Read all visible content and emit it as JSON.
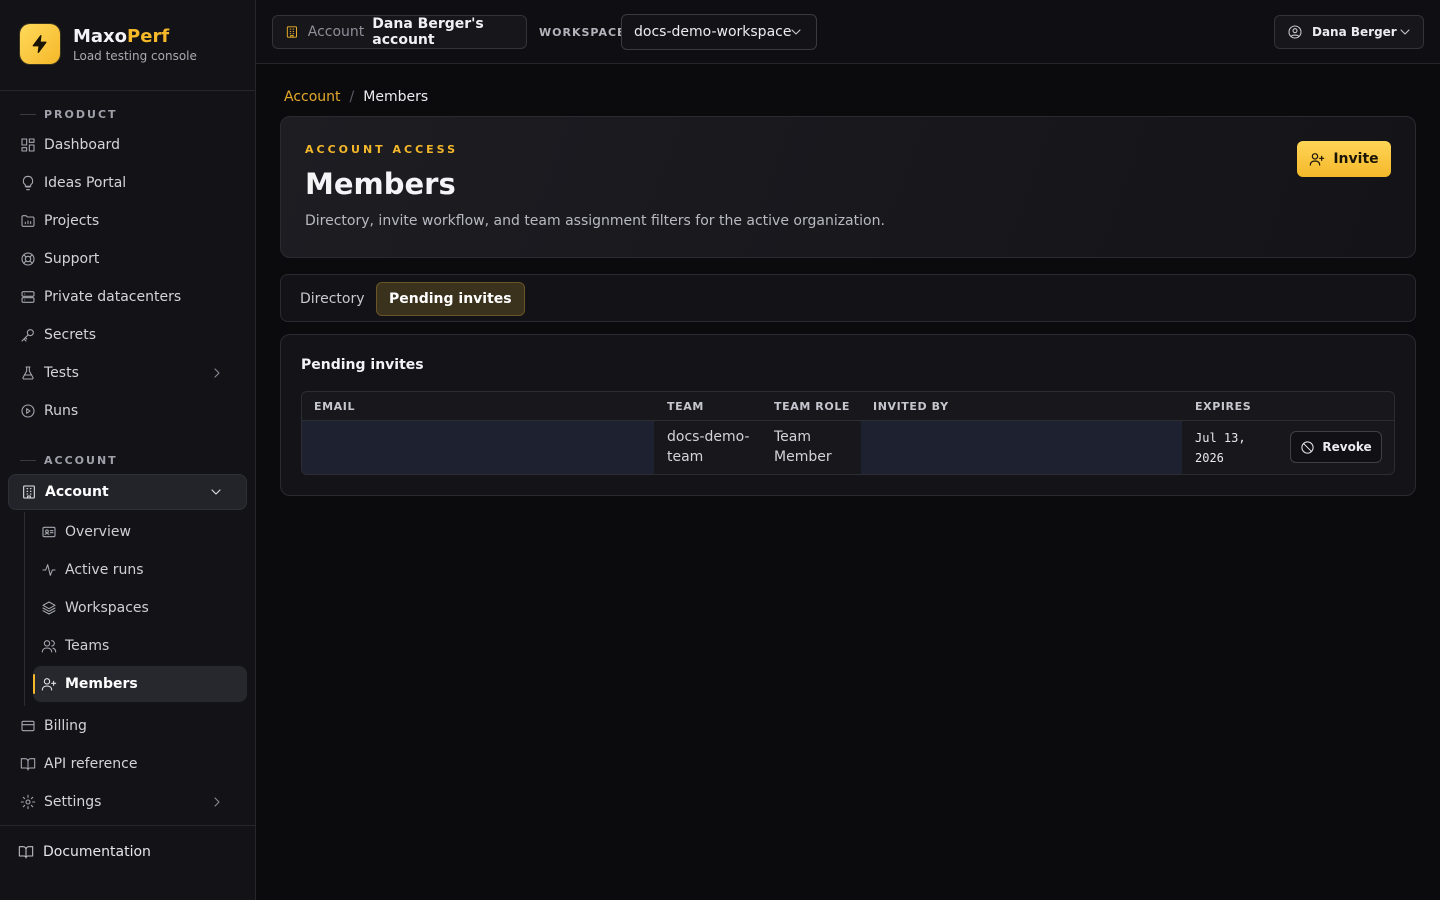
{
  "brand": {
    "name_main": "Maxo",
    "name_accent": "Perf",
    "subtitle": "Load testing console",
    "accent_color": "#f5b82a"
  },
  "sidebar": {
    "product_label": "PRODUCT",
    "product_items": [
      {
        "label": "Dashboard",
        "icon": "dashboard-icon"
      },
      {
        "label": "Ideas Portal",
        "icon": "lightbulb-icon"
      },
      {
        "label": "Projects",
        "icon": "folder-icon"
      },
      {
        "label": "Support",
        "icon": "lifebuoy-icon"
      },
      {
        "label": "Private datacenters",
        "icon": "server-icon"
      },
      {
        "label": "Secrets",
        "icon": "key-icon"
      },
      {
        "label": "Tests",
        "icon": "flask-icon"
      },
      {
        "label": "Runs",
        "icon": "play-circle-icon"
      }
    ],
    "account_label": "ACCOUNT",
    "account_group": "Account",
    "account_sub_items": [
      {
        "label": "Overview",
        "icon": "id-card-icon"
      },
      {
        "label": "Active runs",
        "icon": "activity-icon"
      },
      {
        "label": "Workspaces",
        "icon": "layers-icon"
      },
      {
        "label": "Teams",
        "icon": "users-icon"
      },
      {
        "label": "Members",
        "icon": "user-plus-icon"
      }
    ],
    "account_items": [
      {
        "label": "Billing",
        "icon": "credit-card-icon"
      },
      {
        "label": "API reference",
        "icon": "book-icon"
      },
      {
        "label": "Settings",
        "icon": "gear-icon"
      }
    ],
    "docs": "Documentation"
  },
  "topbar": {
    "account_label": "Account",
    "account_value": "Dana Berger's account",
    "workspace_label": "WORKSPACE",
    "workspace_value": "docs-demo-workspace",
    "user_name": "Dana Berger"
  },
  "breadcrumb": {
    "parent": "Account",
    "current": "Members"
  },
  "hero": {
    "kicker": "ACCOUNT ACCESS",
    "title": "Members",
    "description": "Directory, invite workflow, and team assignment filters for the active organization.",
    "invite_label": "Invite"
  },
  "tabs": [
    {
      "label": "Directory"
    },
    {
      "label": "Pending invites"
    }
  ],
  "pending": {
    "title": "Pending invites",
    "columns": [
      "EMAIL",
      "TEAM",
      "TEAM ROLE",
      "INVITED BY",
      "EXPIRES"
    ],
    "rows": [
      {
        "email": "",
        "team_line1": "docs-demo-",
        "team_line2": "team",
        "role_line1": "Team",
        "role_line2": "Member",
        "invited_by": "",
        "expires_line1": "Jul 13,",
        "expires_line2": "2026",
        "action": "Revoke"
      }
    ]
  }
}
